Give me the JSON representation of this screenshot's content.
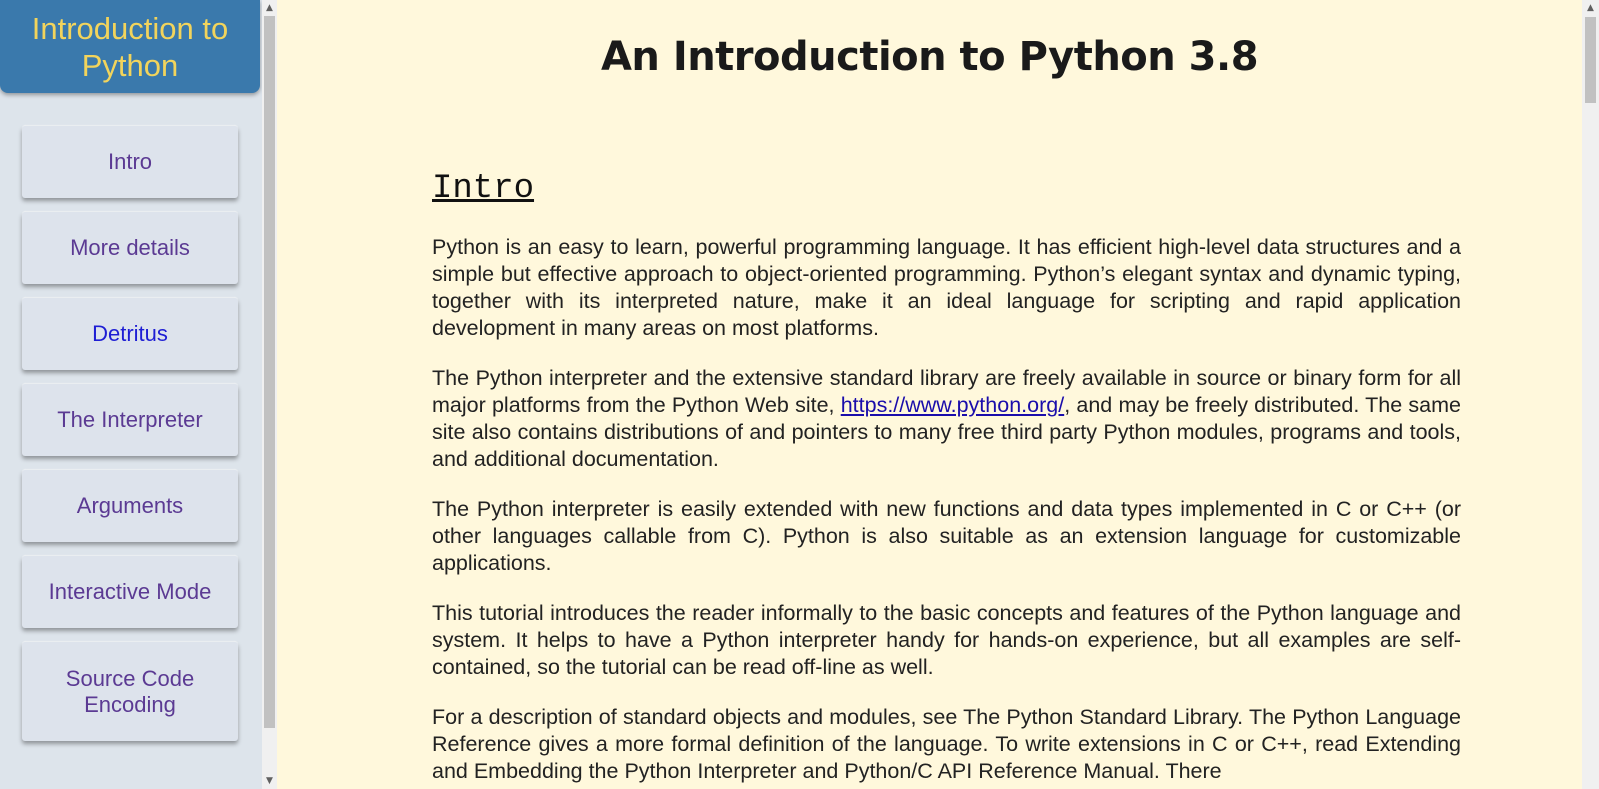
{
  "sidebar": {
    "title": "Introduction to Python",
    "items": [
      {
        "label": "Intro",
        "active": false
      },
      {
        "label": "More details",
        "active": false
      },
      {
        "label": "Detritus",
        "active": true
      },
      {
        "label": "The Interpreter",
        "active": false
      },
      {
        "label": "Arguments",
        "active": false
      },
      {
        "label": "Interactive Mode",
        "active": false
      },
      {
        "label": "Source Code Encoding",
        "active": false
      }
    ]
  },
  "page": {
    "title": "An Introduction to Python 3.8"
  },
  "section": {
    "heading": "Intro",
    "p1": "Python is an easy to learn, powerful programming language. It has efficient high-level data structures and a simple but effective approach to object-oriented programming. Python’s elegant syntax and dynamic typing, together with its interpreted nature, make it an ideal language for scripting and rapid application development in many areas on most platforms.",
    "p2_before": "The Python interpreter and the extensive standard library are freely available in source or binary form for all major platforms from the Python Web site, ",
    "p2_link": "https://www.python.org/",
    "p2_after": ", and may be freely distributed. The same site also contains distributions of and pointers to many free third party Python modules, programs and tools, and additional documentation.",
    "p3": "The Python interpreter is easily extended with new functions and data types implemented in C or C++ (or other languages callable from C). Python is also suitable as an extension language for customizable applications.",
    "p4": "This tutorial introduces the reader informally to the basic concepts and features of the Python language and system. It helps to have a Python interpreter handy for hands-on experience, but all examples are self-contained, so the tutorial can be read off-line as well.",
    "p5": "For a description of standard objects and modules, see The Python Standard Library. The Python Language Reference gives a more formal definition of the language. To write extensions in C or C++, read Extending and Embedding the Python Interpreter and Python/C API Reference Manual. There"
  },
  "colors": {
    "page_background": "#fff8dc",
    "header_background": "#3a79ac",
    "header_text": "#f2d45c",
    "nav_text": "#5b3a93",
    "nav_active_text": "#1e1ed4",
    "link": "#1a0dab"
  },
  "icons": {
    "scroll_up": "triangle-up",
    "scroll_down": "triangle-down"
  }
}
